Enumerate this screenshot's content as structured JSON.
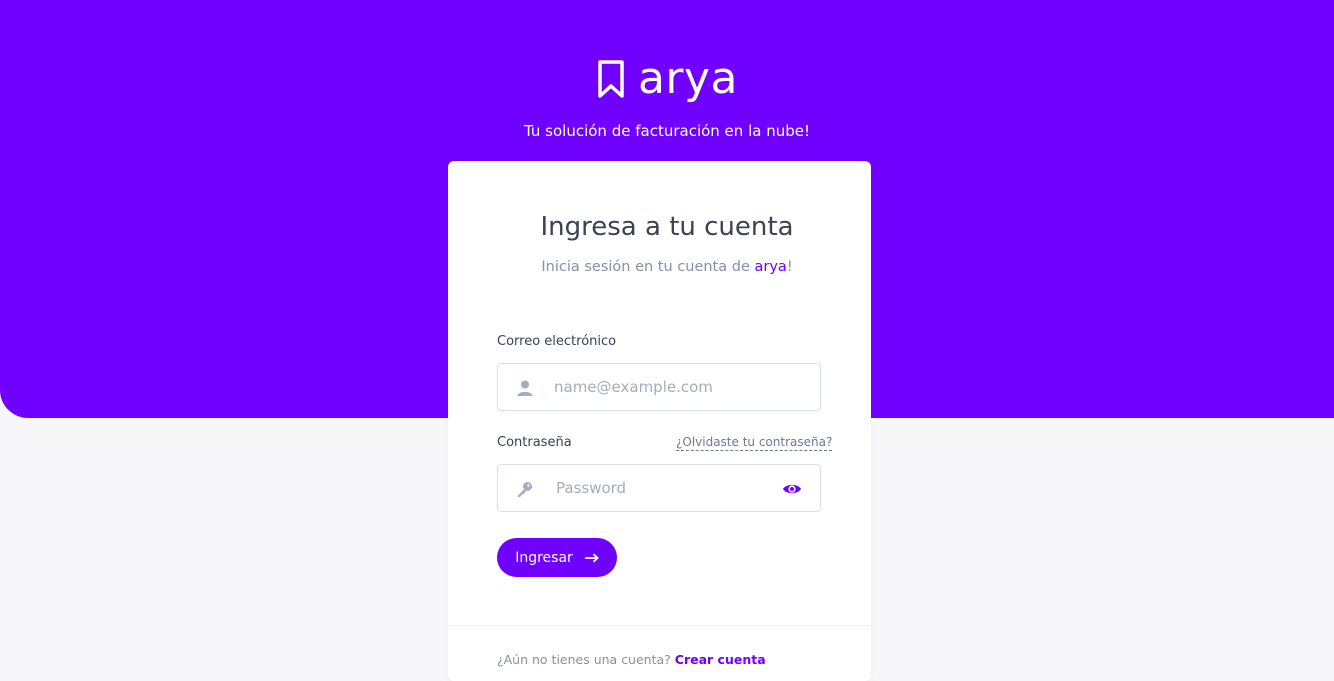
{
  "brand": {
    "name": "arya",
    "icon": "bookmark-icon",
    "tagline": "Tu solución de facturación en la nube!"
  },
  "login": {
    "title": "Ingresa a tu cuenta",
    "subtitle_prefix": "Inicia sesión en tu cuenta de ",
    "subtitle_brand": "arya",
    "subtitle_suffix": "!",
    "email": {
      "label": "Correo electrónico",
      "value": "",
      "placeholder": "name@example.com",
      "icon": "user-icon"
    },
    "password": {
      "label": "Contraseña",
      "value": "",
      "placeholder": "Password",
      "icon": "key-icon",
      "toggle_icon": "eye-icon",
      "forgot_label": "¿Olvidaste tu contraseña?"
    },
    "submit_label": "Ingresar",
    "submit_icon": "arrow-right-icon"
  },
  "footer": {
    "prompt": "¿Aún no tienes una cuenta?",
    "link": "Crear cuenta"
  },
  "colors": {
    "primary": "#7000ff",
    "background": "#f7f7f9",
    "card": "#ffffff"
  }
}
